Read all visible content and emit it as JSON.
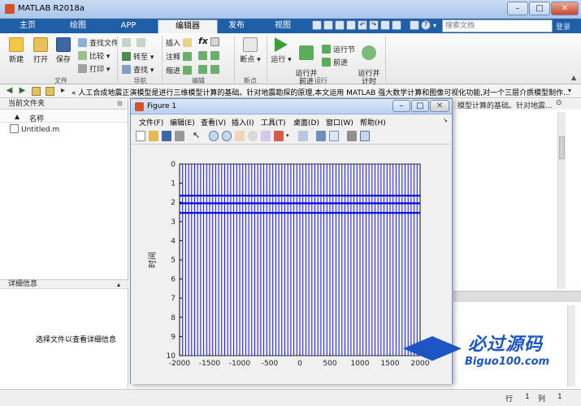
{
  "window": {
    "title": "MATLAB R2018a"
  },
  "tabs": [
    "主页",
    "绘图",
    "APP",
    "编辑器",
    "发布",
    "视图"
  ],
  "active_tab": "编辑器",
  "search": {
    "placeholder": "搜索文档"
  },
  "login": "登录",
  "ribbon": {
    "file_group": {
      "label": "文件",
      "new": "新建",
      "open": "打开",
      "save": "保存",
      "find_files": "查找文件",
      "compare": "比较",
      "print": "打印"
    },
    "nav_group": {
      "label": "导航",
      "goto": "转至",
      "find": "查找"
    },
    "edit_group": {
      "label": "编辑",
      "insert": "插入",
      "comment": "注释",
      "indent": "缩进",
      "fx": "fx"
    },
    "breakpoints_group": {
      "label": "断点",
      "breakpoints": "断点"
    },
    "run_group": {
      "label": "运行",
      "run": "运行",
      "run_advance": "运行并\n前进",
      "run_section": "运行节",
      "advance": "前进",
      "run_time": "运行并\n计时"
    }
  },
  "address_bar": {
    "path": "« 人工合成地震正演模型是进行三维模型计算的基础。针对地震勘探的原理,本文运用 MATLAB 强大数学计算和图像可视化功能,对一个三层介质模型制作..."
  },
  "current_folder": {
    "header": "当前文件夹",
    "name_col": "名称",
    "files": [
      "Untitled.m"
    ]
  },
  "details": {
    "header": "详细信息",
    "message": "选择文件以查看详细信息"
  },
  "right_panel": {
    "header_text": "模型计算的基础。针对地震..."
  },
  "status": {
    "row_label": "行",
    "row": "1",
    "col_label": "列",
    "col": "1"
  },
  "figure": {
    "title": "Figure 1",
    "menu": [
      "文件(F)",
      "编辑(E)",
      "查看(V)",
      "插入(I)",
      "工具(T)",
      "桌面(D)",
      "窗口(W)",
      "帮助(H)"
    ]
  },
  "watermark": {
    "big": "必过源码",
    "small": "Biguo100.com"
  },
  "chart_data": {
    "type": "line",
    "ylabel": "时间",
    "xlabel": "",
    "title": "",
    "xlim": [
      -2000,
      2000
    ],
    "ylim": [
      0,
      10
    ],
    "y_reversed": true,
    "x_ticks": [
      -2000,
      -1500,
      -1000,
      -500,
      0,
      500,
      1000,
      1500,
      2000
    ],
    "y_ticks": [
      0,
      1,
      2,
      3,
      4,
      5,
      6,
      7,
      8,
      9,
      10
    ],
    "trace_spacing": 50,
    "trace_count": 81,
    "reflectors": [
      1.65,
      2.05,
      2.55
    ],
    "color": "#0000ff"
  }
}
